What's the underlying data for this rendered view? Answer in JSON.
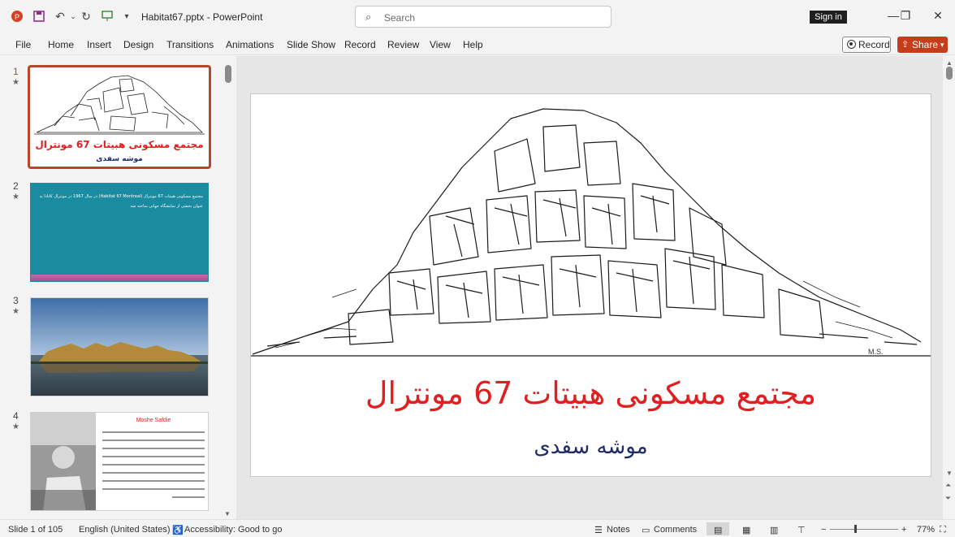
{
  "titlebar": {
    "doc_title": "Habitat67.pptx  -  PowerPoint",
    "search_placeholder": "Search",
    "signin_label": "Sign in"
  },
  "menu": {
    "items": [
      "File",
      "Home",
      "Insert",
      "Design",
      "Transitions",
      "Animations",
      "Slide Show",
      "Record",
      "Review",
      "View",
      "Help"
    ],
    "record_label": "Record",
    "share_label": "Share"
  },
  "thumbnails": [
    {
      "number": "1",
      "title": "مجتمع مسکونی هبیتات 67 مونترال",
      "subtitle": "موشه سفدی"
    },
    {
      "number": "2",
      "body": "مجتمع مسکونی هبیتات 67 مونترال (Habitat 67 Montreal) در سال 1967 در مونترال کانادا به عنوان بخشی از نمایشگاه جهانی ساخته شد"
    },
    {
      "number": "3"
    },
    {
      "number": "4",
      "heading": "Moshe Safdie"
    }
  ],
  "slide": {
    "title": "مجتمع مسکونی هبیتات 67 مونترال",
    "subtitle": "موشه سفدی"
  },
  "status": {
    "slide_count": "Slide 1 of 105",
    "language": "English (United States)",
    "accessibility": "Accessibility: Good to go",
    "notes_label": "Notes",
    "comments_label": "Comments",
    "zoom": "77%"
  },
  "colors": {
    "accent": "#c43e1c",
    "selection_border": "#b7472a",
    "slide_title": "#e02020",
    "slide_subtitle": "#1f2a6b",
    "slide2_background": "#1a8ba0"
  }
}
